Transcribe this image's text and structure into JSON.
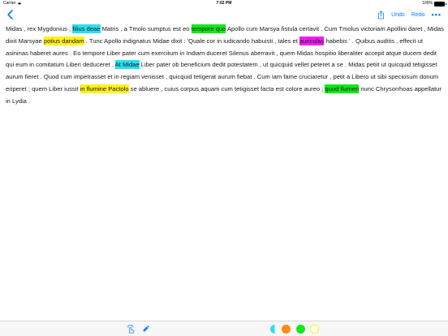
{
  "statusbar": {
    "carrier": "Carrier",
    "time": "7:02 PM",
    "battery_text": "100%",
    "battery_level": 1.0
  },
  "navbar": {
    "undo_label": "Undo",
    "redo_label": "Redo",
    "more_label": "•••"
  },
  "text": {
    "t1": "Midas , rex Mygdonius , ",
    "h1": "filius deae",
    "t2": " Matris , a Tmolo sumptus est eo ",
    "h2": "tempore quo",
    "t3": " Apollo cum Marsya fistula certavit . Cum Tmolus victoriam Apollini daret , Midas dixit Marsyae ",
    "h3": "potius dandam",
    "t4": " . Tunc Apollo indignatus Midae dixit : 'Quale cor in iudicando habuisti , tales et ",
    "h4": "auriculas",
    "t5": " habebis ' . Quibus auditis , effecit ut asininas haberet aures . Eo tempore Liber pater cum exercitum in Indiam duceret Silenus aberravit , quem Midas hospitio liberaliter accepit atque ducem dedit qui eum in comitatum Liberi deduceret . ",
    "h5": "At Midae",
    "t6": " Liber pater ob beneficium dedit potestatem , ut quicquid vellet peteret a se . Midas petiit ut quicquid tetigisset aurum fieret . Quod cum impetrasset et in regiam venisset , quicquid tetigerat aurum fiebat . Cum iam fame cruciaretur , petit a Libero ut sibi speciosum donum eriperet ; quem Liber iussit ",
    "h6": "in flumine Pactolo",
    "t7": " se abluere , cuius corpus aquam cum tetigisset facta est colore aureo ; ",
    "h7": "quod flumen",
    "t8": " nunc Chrysorrhoas appellatur in Lydia ."
  },
  "colors": {
    "accent": "#0a7cff",
    "highlight_cyan": "#29e0f0",
    "highlight_yellow": "#fff21a",
    "highlight_green": "#10e818",
    "highlight_magenta": "#f01ef0",
    "palette_orange": "#ff8a14"
  },
  "toolbar": {
    "tools": [
      "tap-tool-icon",
      "highlighter-tool-icon"
    ],
    "palette": [
      "cyan",
      "orange",
      "green",
      "yellow"
    ],
    "selected_color": "cyan"
  }
}
